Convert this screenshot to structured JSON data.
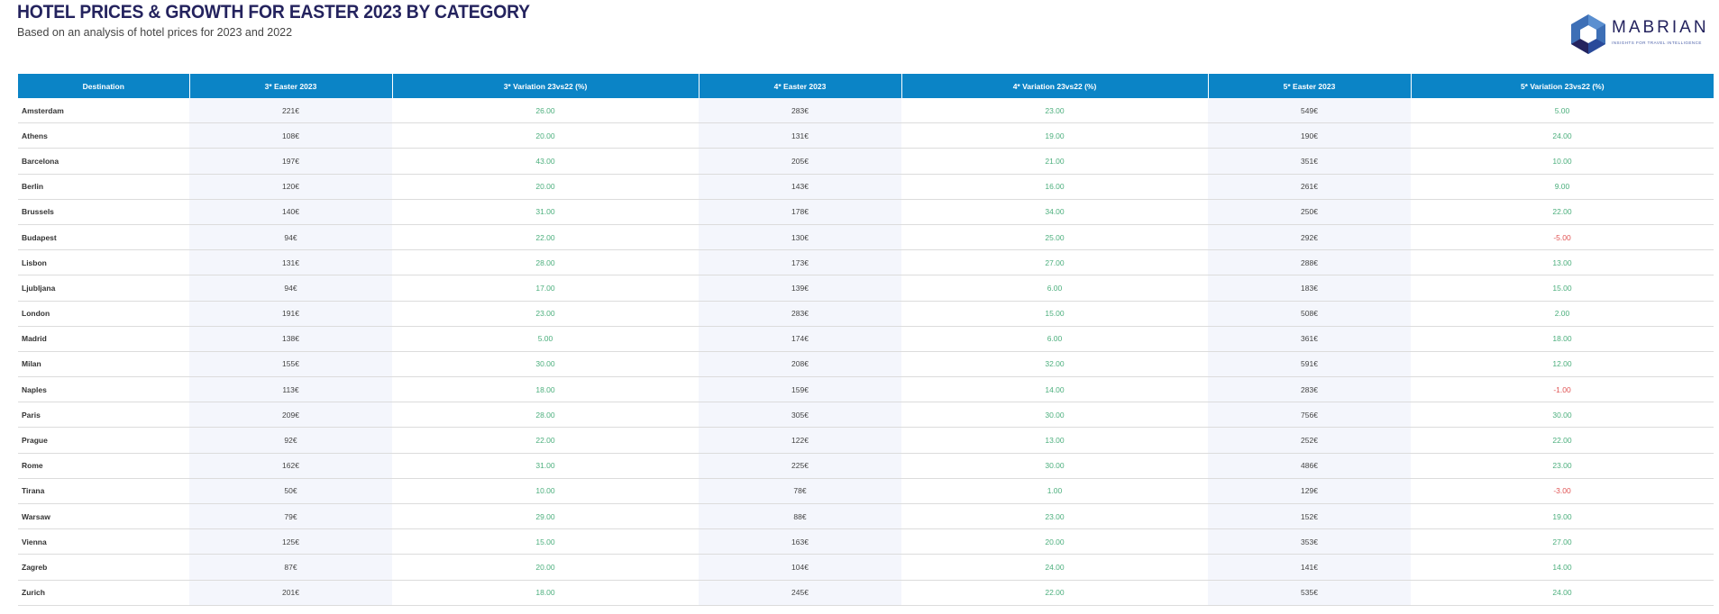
{
  "header": {
    "title": "HOTEL PRICES & GROWTH FOR EASTER 2023 BY CATEGORY",
    "subtitle": "Based on an analysis of hotel prices for 2023 and 2022"
  },
  "logo": {
    "wordmark": "MABRIAN",
    "tagline": "INSIGHTS FOR TRAVEL INTELLIGENCE",
    "colors": {
      "dark": "#24235e",
      "light": "#3d6fb6",
      "accent": "#2a4a9a"
    }
  },
  "colors": {
    "header_bg": "#0b84c6",
    "title": "#24235e",
    "positive": "#4caf7d",
    "negative": "#e05353",
    "price_col_bg": "#f4f6fc"
  },
  "chart_data": {
    "type": "table",
    "columns": [
      "Destination",
      "3* Easter 2023",
      "3* Variation 23vs22 (%)",
      "4* Easter 2023",
      "4* Variation 23vs22 (%)",
      "5* Easter 2023",
      "5* Variation 23vs22 (%)"
    ],
    "rows": [
      [
        "Amsterdam",
        "221€",
        "26.00",
        "283€",
        "23.00",
        "549€",
        "5.00"
      ],
      [
        "Athens",
        "108€",
        "20.00",
        "131€",
        "19.00",
        "190€",
        "24.00"
      ],
      [
        "Barcelona",
        "197€",
        "43.00",
        "205€",
        "21.00",
        "351€",
        "10.00"
      ],
      [
        "Berlin",
        "120€",
        "20.00",
        "143€",
        "16.00",
        "261€",
        "9.00"
      ],
      [
        "Brussels",
        "140€",
        "31.00",
        "178€",
        "34.00",
        "250€",
        "22.00"
      ],
      [
        "Budapest",
        "94€",
        "22.00",
        "130€",
        "25.00",
        "292€",
        "-5.00"
      ],
      [
        "Lisbon",
        "131€",
        "28.00",
        "173€",
        "27.00",
        "288€",
        "13.00"
      ],
      [
        "Ljubljana",
        "94€",
        "17.00",
        "139€",
        "6.00",
        "183€",
        "15.00"
      ],
      [
        "London",
        "191€",
        "23.00",
        "283€",
        "15.00",
        "508€",
        "2.00"
      ],
      [
        "Madrid",
        "138€",
        "5.00",
        "174€",
        "6.00",
        "361€",
        "18.00"
      ],
      [
        "Milan",
        "155€",
        "30.00",
        "208€",
        "32.00",
        "591€",
        "12.00"
      ],
      [
        "Naples",
        "113€",
        "18.00",
        "159€",
        "14.00",
        "283€",
        "-1.00"
      ],
      [
        "Paris",
        "209€",
        "28.00",
        "305€",
        "30.00",
        "756€",
        "30.00"
      ],
      [
        "Prague",
        "92€",
        "22.00",
        "122€",
        "13.00",
        "252€",
        "22.00"
      ],
      [
        "Rome",
        "162€",
        "31.00",
        "225€",
        "30.00",
        "486€",
        "23.00"
      ],
      [
        "Tirana",
        "50€",
        "10.00",
        "78€",
        "1.00",
        "129€",
        "-3.00"
      ],
      [
        "Warsaw",
        "79€",
        "29.00",
        "88€",
        "23.00",
        "152€",
        "19.00"
      ],
      [
        "Vienna",
        "125€",
        "15.00",
        "163€",
        "20.00",
        "353€",
        "27.00"
      ],
      [
        "Zagreb",
        "87€",
        "20.00",
        "104€",
        "24.00",
        "141€",
        "14.00"
      ],
      [
        "Zurich",
        "201€",
        "18.00",
        "245€",
        "22.00",
        "535€",
        "24.00"
      ]
    ]
  }
}
